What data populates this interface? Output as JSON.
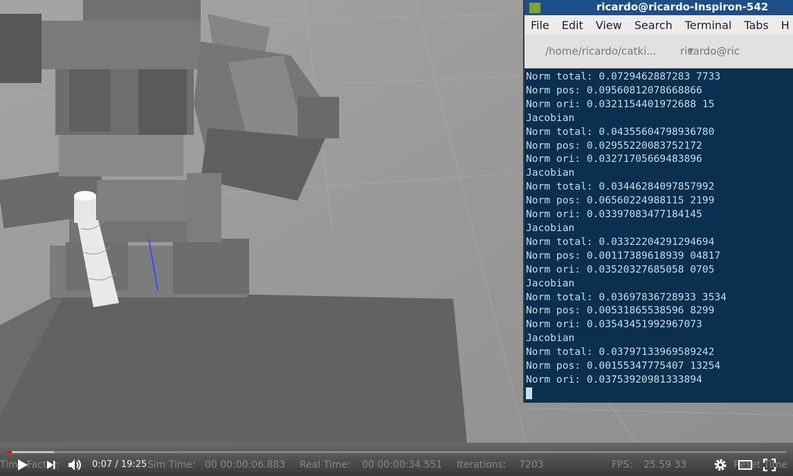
{
  "terminal": {
    "title": "ricardo@ricardo-Inspiron-542",
    "menu": [
      "File",
      "Edit",
      "View",
      "Search",
      "Terminal",
      "Tabs",
      "H"
    ],
    "tabs": [
      {
        "label": "/home/ricardo/catki...",
        "close": "▼"
      },
      {
        "label": "ricardo@ric"
      }
    ],
    "lines": [
      "Norm total: 0.0729462887283 7733",
      "Norm pos: 0.09560812078668866",
      "Norm ori: 0.0321154401972688 15",
      "Jacobian",
      "Norm total: 0.04355604798936780",
      "Norm pos: 0.02955220083752172",
      "Norm ori: 0.03271705669483896",
      "Jacobian",
      "Norm total: 0.03446284097857992",
      "Norm pos: 0.06560224988115 2199",
      "Norm ori: 0.03397083477184145",
      "Jacobian",
      "Norm total: 0.03322204291294694",
      "Norm pos: 0.00117389618939 04817",
      "Norm ori: 0.03520327685058 0705",
      "Jacobian",
      "Norm total: 0.03697836728933 3534",
      "Norm pos: 0.00531865538596 8299",
      "Norm ori: 0.03543451992967073",
      "Jacobian",
      "Norm total: 0.03797133969589242",
      "Norm pos: 0.00155347775407 13254",
      "Norm ori: 0.03753920981333894"
    ]
  },
  "gazebo_bar": {
    "time_factor_label": "Time Factor:",
    "sim_time_label": "Sim Time:",
    "sim_time_value": "00 00:00:06.883",
    "real_time_label": "Real Time:",
    "real_time_value": "00 00:00:34.551",
    "iterations_label": "Iterations:",
    "iterations_value": "7203",
    "fps_label": "FPS:",
    "fps_value": "25.59 33",
    "reset_label": "Reset Time"
  },
  "player": {
    "current_time": "0:07",
    "duration": "19:25",
    "time_separator": " / ",
    "progress": 0.006,
    "buffered": 0.06,
    "icons": {
      "play": "play-icon",
      "next": "next-icon",
      "volume": "volume-icon",
      "settings": "gear-icon",
      "theater": "theater-icon",
      "fullscreen": "fullscreen-icon"
    },
    "accent_color": "#ff0000"
  }
}
